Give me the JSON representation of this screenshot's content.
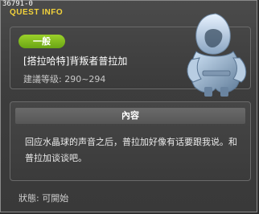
{
  "window": {
    "quest_id": "36791-0",
    "title": "QUEST INFO"
  },
  "quest": {
    "badge": "一般",
    "name": "[搭拉哈特]背叛者普拉加",
    "level": "建議等级: 290~294"
  },
  "content": {
    "header": "內容",
    "description": "回应水晶球的声音之后，普拉加好像有话要跟我说。和普拉加谈谈吧。"
  },
  "status": {
    "text": "狀態: 可開始"
  }
}
